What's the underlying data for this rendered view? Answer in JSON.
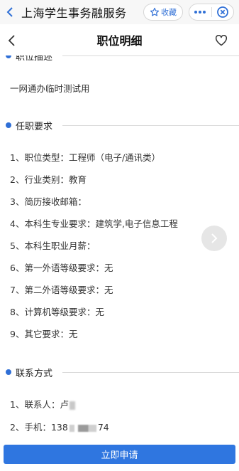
{
  "miniapp": {
    "title": "上海学生事务融服务",
    "favorite_label": "收藏"
  },
  "nav": {
    "title": "职位明细"
  },
  "sections": {
    "description": {
      "title": "职位描述",
      "text": "一网通办临时测试用"
    },
    "requirements": {
      "title": "任职要求",
      "items": [
        "1、职位类型：工程师（电子/通讯类）",
        "2、行业类别：教育",
        "3、简历接收邮箱：",
        "4、本科生专业要求：建筑学,电子信息工程",
        "5、本科生职业月薪：",
        "6、第一外语等级要求：无",
        "7、第二外语等级要求：无",
        "8、计算机等级要求：无",
        "9、其它要求：无"
      ]
    },
    "contact": {
      "title": "联系方式",
      "person_label": "1、联系人：卢",
      "phone_label": "2、手机：138",
      "phone_tail": "74"
    }
  },
  "actions": {
    "apply_label": "立即申请"
  },
  "colors": {
    "accent": "#2f6fd6",
    "button": "#2f76e0"
  }
}
